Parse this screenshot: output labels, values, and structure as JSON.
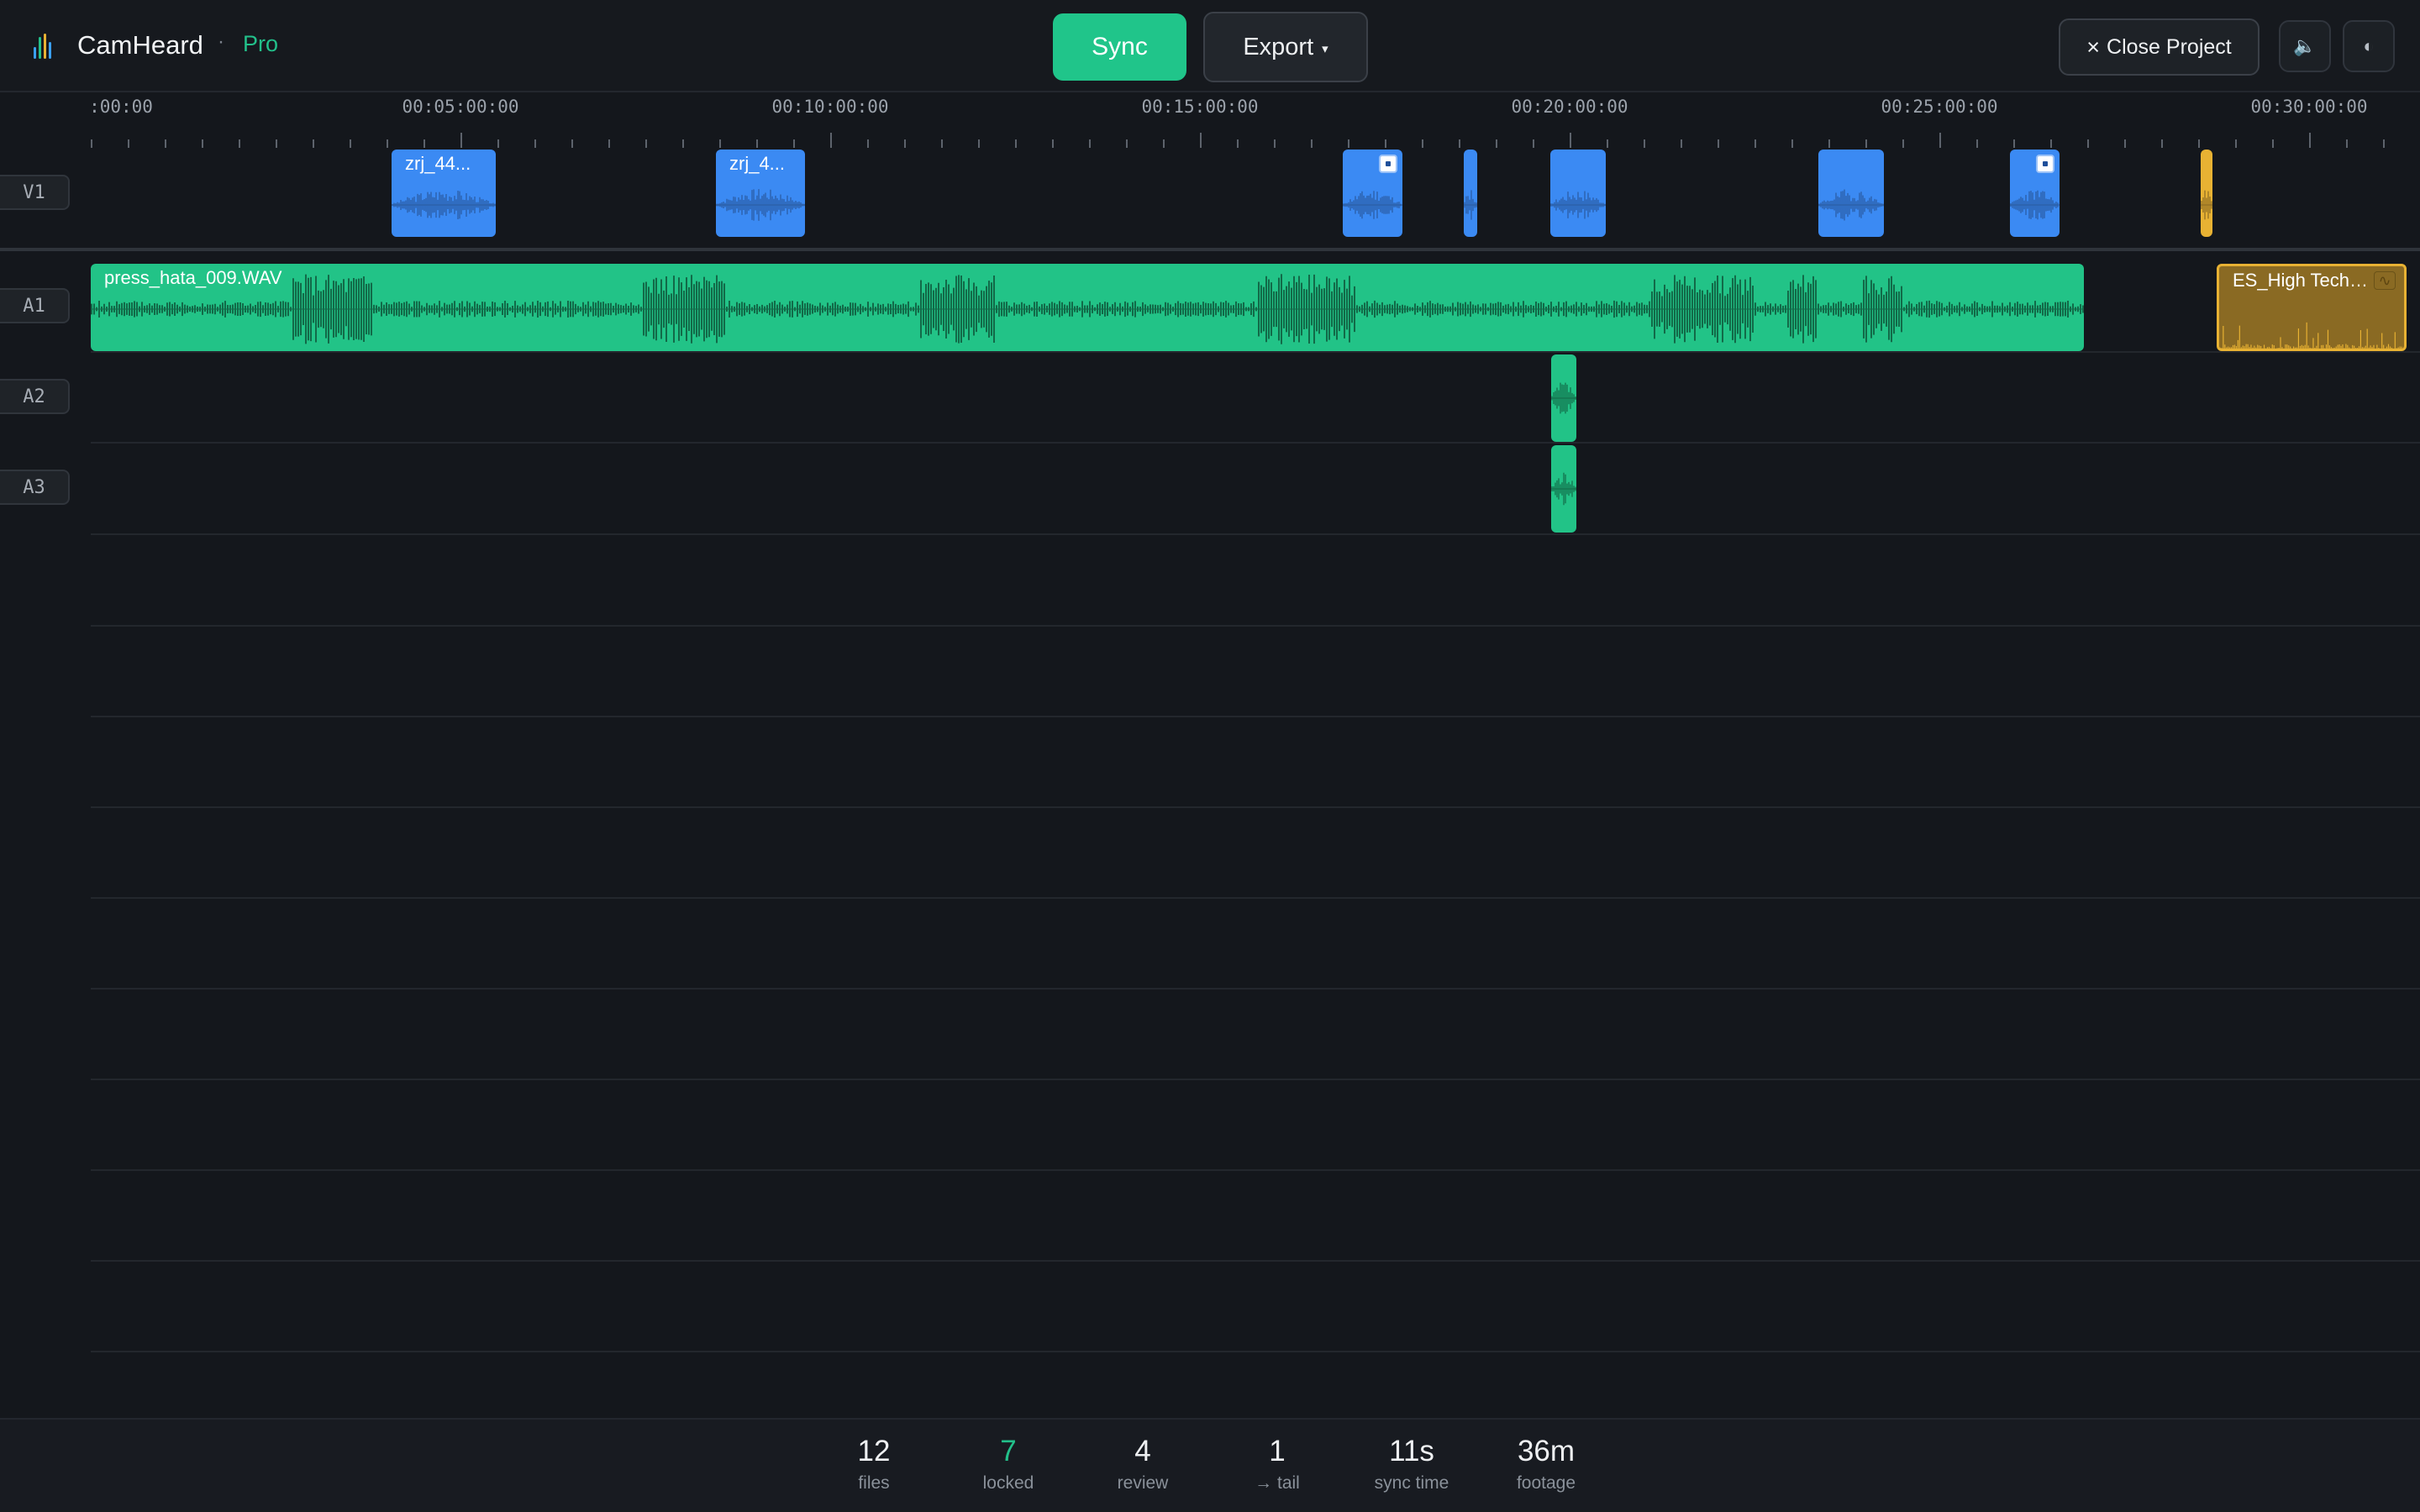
{
  "header": {
    "app_name": "CamHeard",
    "separator": "·",
    "tier": "Pro",
    "sync_label": "Sync",
    "export_label": "Export",
    "export_caret": "▾",
    "close_icon": "×",
    "close_label": "Close Project",
    "volume_icon": "🔈",
    "theme_icon": "◐"
  },
  "ruler": {
    "labels": [
      ":00:00",
      "00:05:00:00",
      "00:10:00:00",
      "00:15:00:00",
      "00:20:00:00",
      "00:25:00:00",
      "00:30:00:00"
    ]
  },
  "tracks": {
    "labels": [
      "V1",
      "A1",
      "A2",
      "A3"
    ],
    "v1_clips": [
      "zrj_44...",
      "zrj_4..."
    ],
    "a1_clips": [
      "press_hata_009.WAV",
      "ES_High Tech - ..."
    ],
    "a1_music_icon": "∿"
  },
  "stats": [
    {
      "value": "12",
      "label": "files"
    },
    {
      "value": "7",
      "label": "locked"
    },
    {
      "value": "4",
      "label": "review"
    },
    {
      "value": "1",
      "label": "→ tail"
    },
    {
      "value": "11s",
      "label": "sync time"
    },
    {
      "value": "36m",
      "label": "footage"
    }
  ],
  "colors": {
    "accent": "#20c58a",
    "video_clip": "#3b8af3",
    "audio_clip": "#22c387",
    "music_clip": "#e8b233"
  }
}
